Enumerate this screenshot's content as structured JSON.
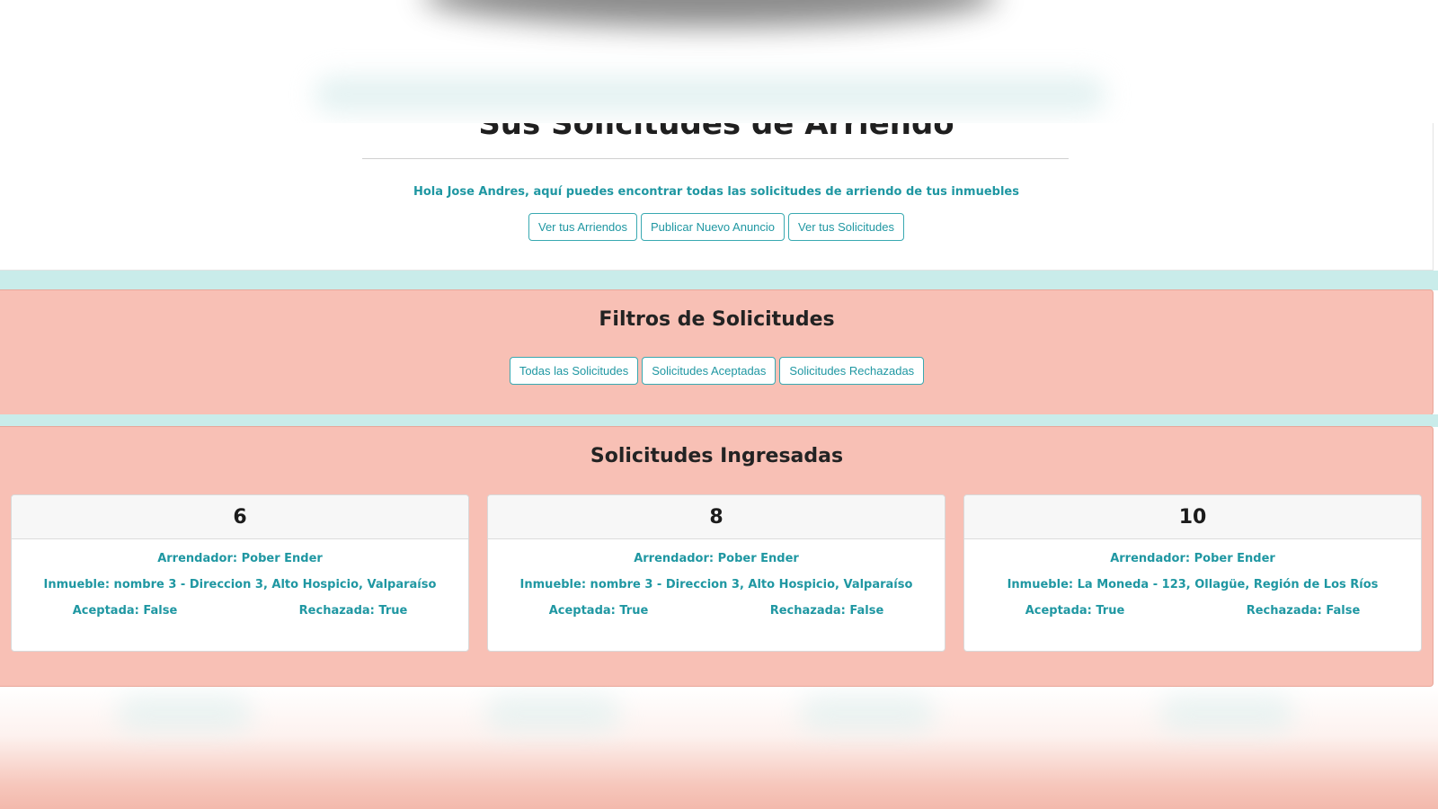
{
  "header": {
    "title": "Sus Solicitudes de Arriendo",
    "greeting": "Hola Jose Andres, aquí puedes encontrar todas las solicitudes de arriendo de tus inmuebles",
    "buttons": {
      "arriendos": "Ver tus Arriendos",
      "publicar": "Publicar Nuevo Anuncio",
      "solicitudes": "Ver tus Solicitudes"
    }
  },
  "filters": {
    "title": "Filtros de Solicitudes",
    "buttons": {
      "todas": "Todas las Solicitudes",
      "aceptadas": "Solicitudes Aceptadas",
      "rechazadas": "Solicitudes Rechazadas"
    }
  },
  "solicitudes": {
    "title": "Solicitudes Ingresadas",
    "cards": [
      {
        "id": "6",
        "arrendador": "Arrendador: Pober Ender",
        "inmueble": "Inmueble: nombre 3 - Direccion 3, Alto Hospicio, Valparaíso",
        "aceptada": "Aceptada: False",
        "rechazada": "Rechazada: True"
      },
      {
        "id": "8",
        "arrendador": "Arrendador: Pober Ender",
        "inmueble": "Inmueble: nombre 3 - Direccion 3, Alto Hospicio, Valparaíso",
        "aceptada": "Aceptada: True",
        "rechazada": "Rechazada: False"
      },
      {
        "id": "10",
        "arrendador": "Arrendador: Pober Ender",
        "inmueble": "Inmueble: La Moneda - 123, Ollagüe, Región de Los Ríos",
        "aceptada": "Aceptada: True",
        "rechazada": "Rechazada: False"
      }
    ]
  },
  "colors": {
    "accent": "#1f97a2",
    "salmon": "#f8c0b5",
    "mint": "#c9ecea"
  }
}
